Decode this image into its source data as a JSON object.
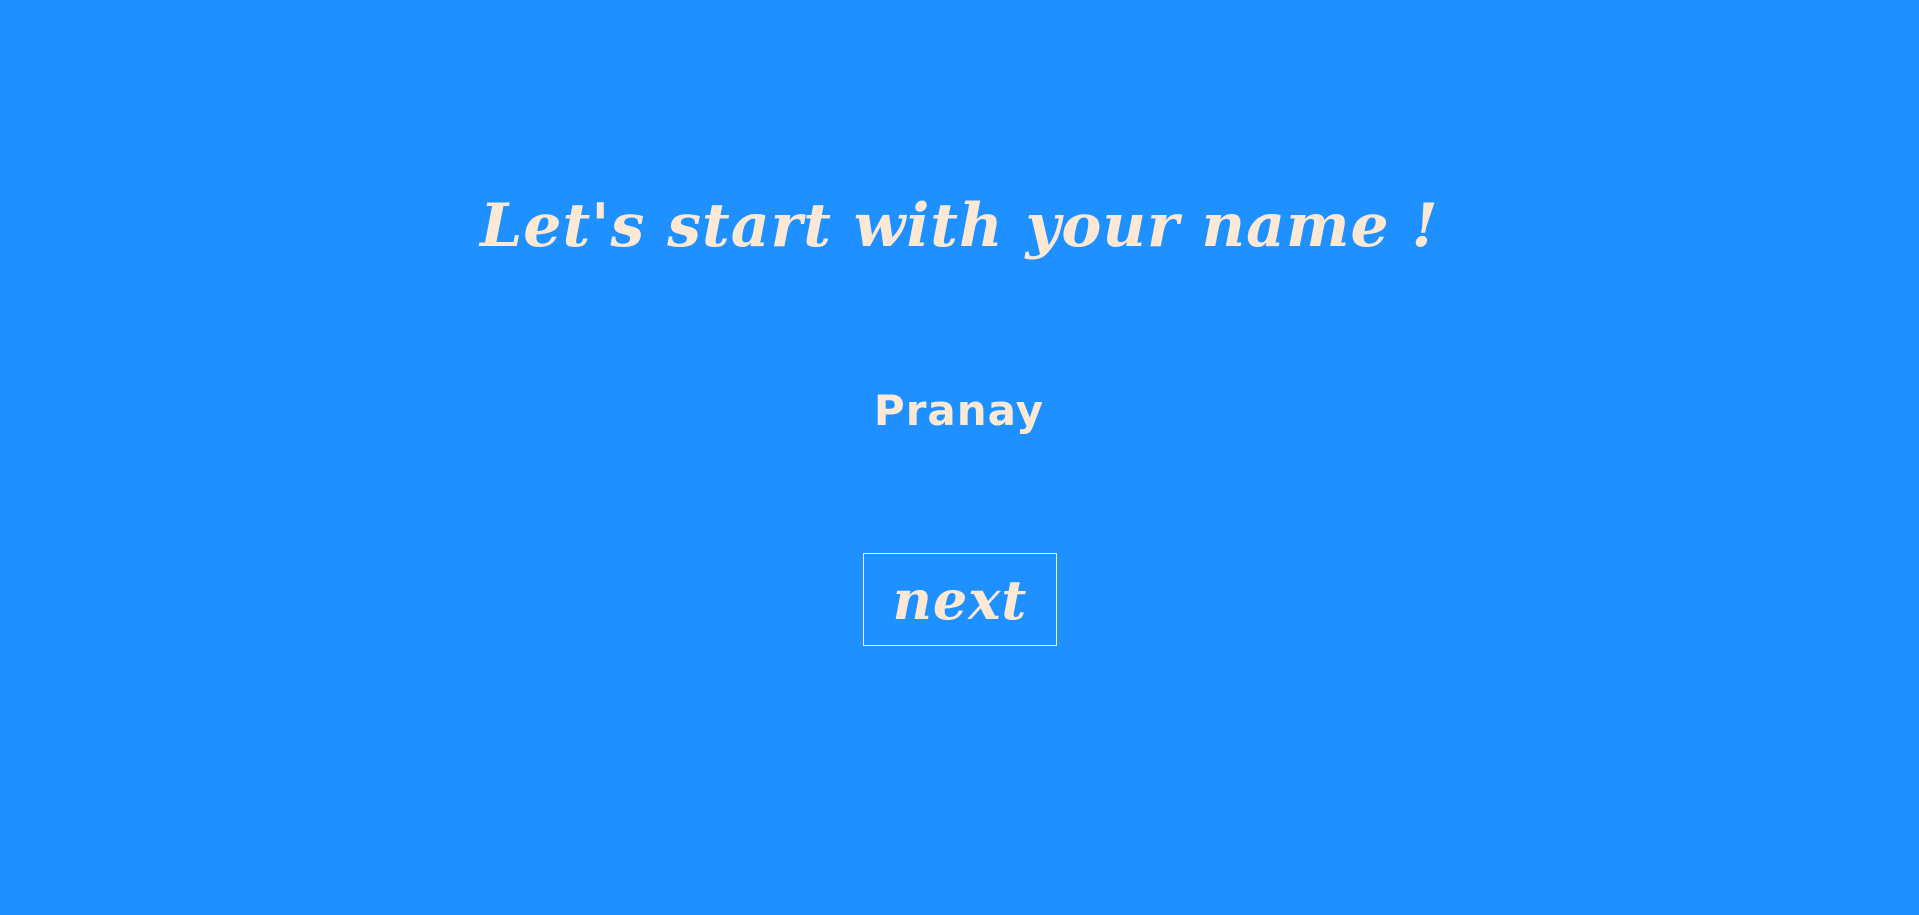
{
  "page": {
    "background_color": "#1e90ff",
    "text_color": "#fbe9d6"
  },
  "prompt": {
    "title": "Let's start with your name !"
  },
  "name_field": {
    "value": "Pranay"
  },
  "actions": {
    "next_label": "next"
  }
}
